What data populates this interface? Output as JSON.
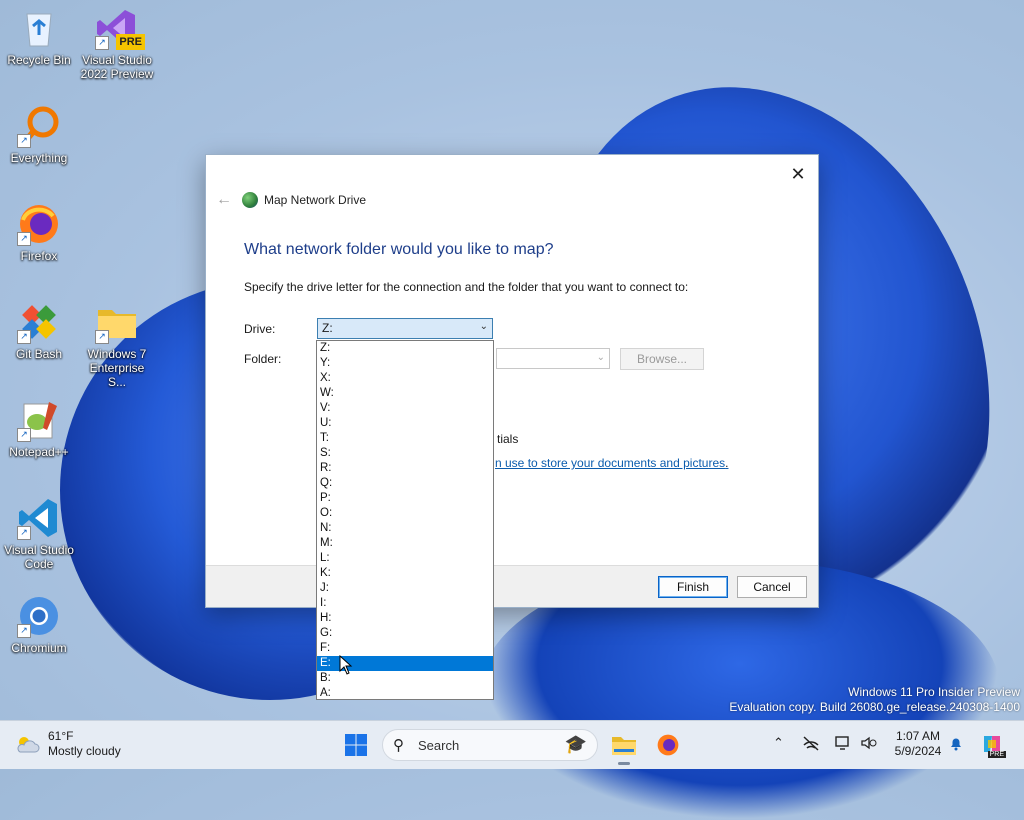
{
  "desktop": {
    "icons": [
      {
        "label": "Recycle Bin",
        "icon": "recycle-bin-icon"
      },
      {
        "label": "Visual Studio 2022 Preview",
        "icon": "visual-studio-icon",
        "badge": "PRE"
      },
      {
        "label": "Everything",
        "icon": "everything-search-icon"
      },
      {
        "label": "Firefox",
        "icon": "firefox-icon"
      },
      {
        "label": "Git Bash",
        "icon": "git-bash-icon"
      },
      {
        "label": "Windows 7 Enterprise S...",
        "icon": "folder-icon"
      },
      {
        "label": "Notepad++",
        "icon": "notepad-plus-plus-icon"
      },
      {
        "label": "Visual Studio Code",
        "icon": "vscode-icon"
      },
      {
        "label": "Chromium",
        "icon": "chromium-icon"
      }
    ]
  },
  "dialog": {
    "title": "Map Network Drive",
    "heading": "What network folder would you like to map?",
    "instruction": "Specify the drive letter for the connection and the folder that you want to connect to:",
    "drive_label": "Drive:",
    "drive_value": "Z:",
    "folder_label": "Folder:",
    "folder_value": "",
    "browse_label": "Browse...",
    "partial_text": "tials",
    "partial_link": "n use to store your documents and pictures",
    "partial_link_end": ".",
    "finish_label": "Finish",
    "cancel_label": "Cancel",
    "close_glyph": "✕",
    "back_glyph": "←"
  },
  "drive_options": [
    "Z:",
    "Y:",
    "X:",
    "W:",
    "V:",
    "U:",
    "T:",
    "S:",
    "R:",
    "Q:",
    "P:",
    "O:",
    "N:",
    "M:",
    "L:",
    "K:",
    "J:",
    "I:",
    "H:",
    "G:",
    "F:",
    "E:",
    "B:",
    "A:"
  ],
  "drive_highlighted": "E:",
  "watermark": {
    "line1": "Windows 11 Pro Insider Preview",
    "line2": "Evaluation copy. Build 26080.ge_release.240308-1400"
  },
  "taskbar": {
    "weather_temp": "61°F",
    "weather_desc": "Mostly cloudy",
    "search_placeholder": "Search",
    "time": "1:07 AM",
    "date": "5/9/2024",
    "copilot_badge": "PRE"
  },
  "colors": {
    "accent": "#0078d7",
    "heading": "#1e3e8a",
    "link": "#0b5cad"
  }
}
